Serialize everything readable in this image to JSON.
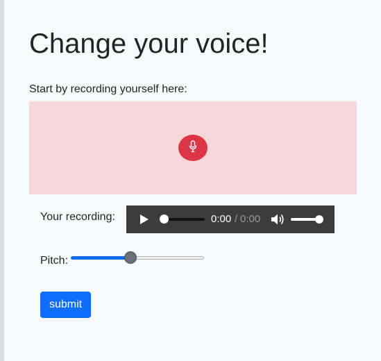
{
  "page": {
    "title": "Change your voice!"
  },
  "recorder": {
    "intro_text": "Start by recording yourself here:",
    "mic_icon": "microphone-icon",
    "panel_color": "#f8d7da",
    "button_color": "#dc3545"
  },
  "playback": {
    "label": "Your recording:",
    "current_time": "0:00",
    "separator": "/",
    "duration": "0:00",
    "progress": 0,
    "volume": 1,
    "play_icon": "play-icon",
    "volume_icon": "volume-icon"
  },
  "pitch": {
    "label": "Pitch:",
    "value_fraction": 0.45,
    "accent": "#0d6efd"
  },
  "form": {
    "submit_label": "submit",
    "submit_color": "#0d6efd"
  }
}
